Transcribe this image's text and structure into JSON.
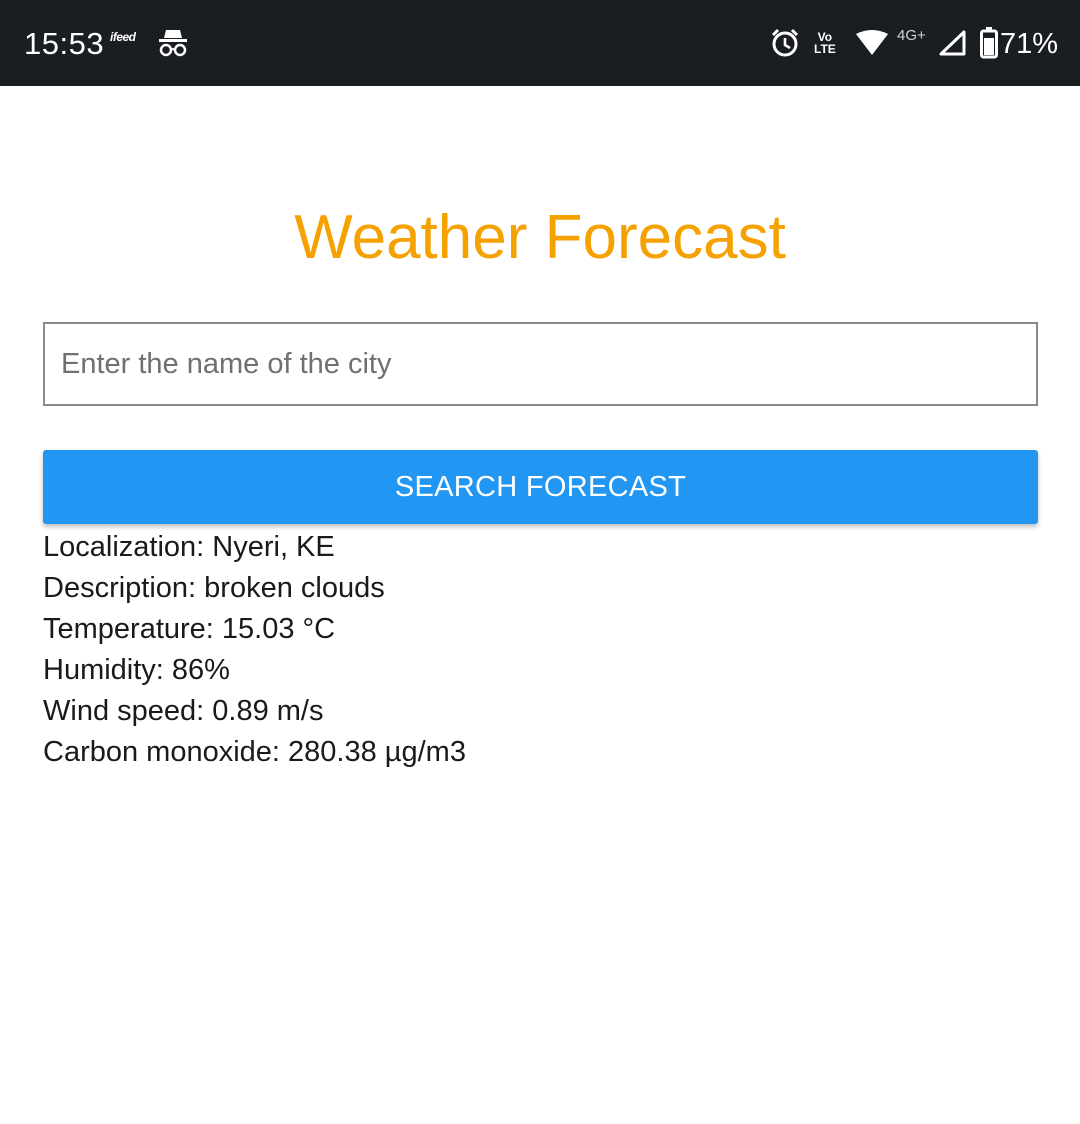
{
  "status_bar": {
    "time": "15:53",
    "ifeed_label": "ifeed",
    "volte_top": "Vo",
    "volte_bottom": "LTE",
    "network_type": "4G+",
    "battery_percent": "71%",
    "icons": [
      "ifeed-icon",
      "incognito-icon",
      "alarm-icon",
      "volte-icon",
      "wifi-icon",
      "signal-icon",
      "battery-icon"
    ]
  },
  "app": {
    "title": "Weather Forecast",
    "title_color": "#f5a100",
    "search": {
      "placeholder": "Enter the name of the city",
      "value": ""
    },
    "search_button_label": "SEARCH FORECAST",
    "accent_color": "#2196f3",
    "results": [
      "Localization: Nyeri, KE",
      "Description: broken clouds",
      "Temperature: 15.03 °C",
      "Humidity: 86%",
      "Wind speed: 0.89 m/s",
      "Carbon monoxide: 280.38 µg/m3"
    ]
  }
}
